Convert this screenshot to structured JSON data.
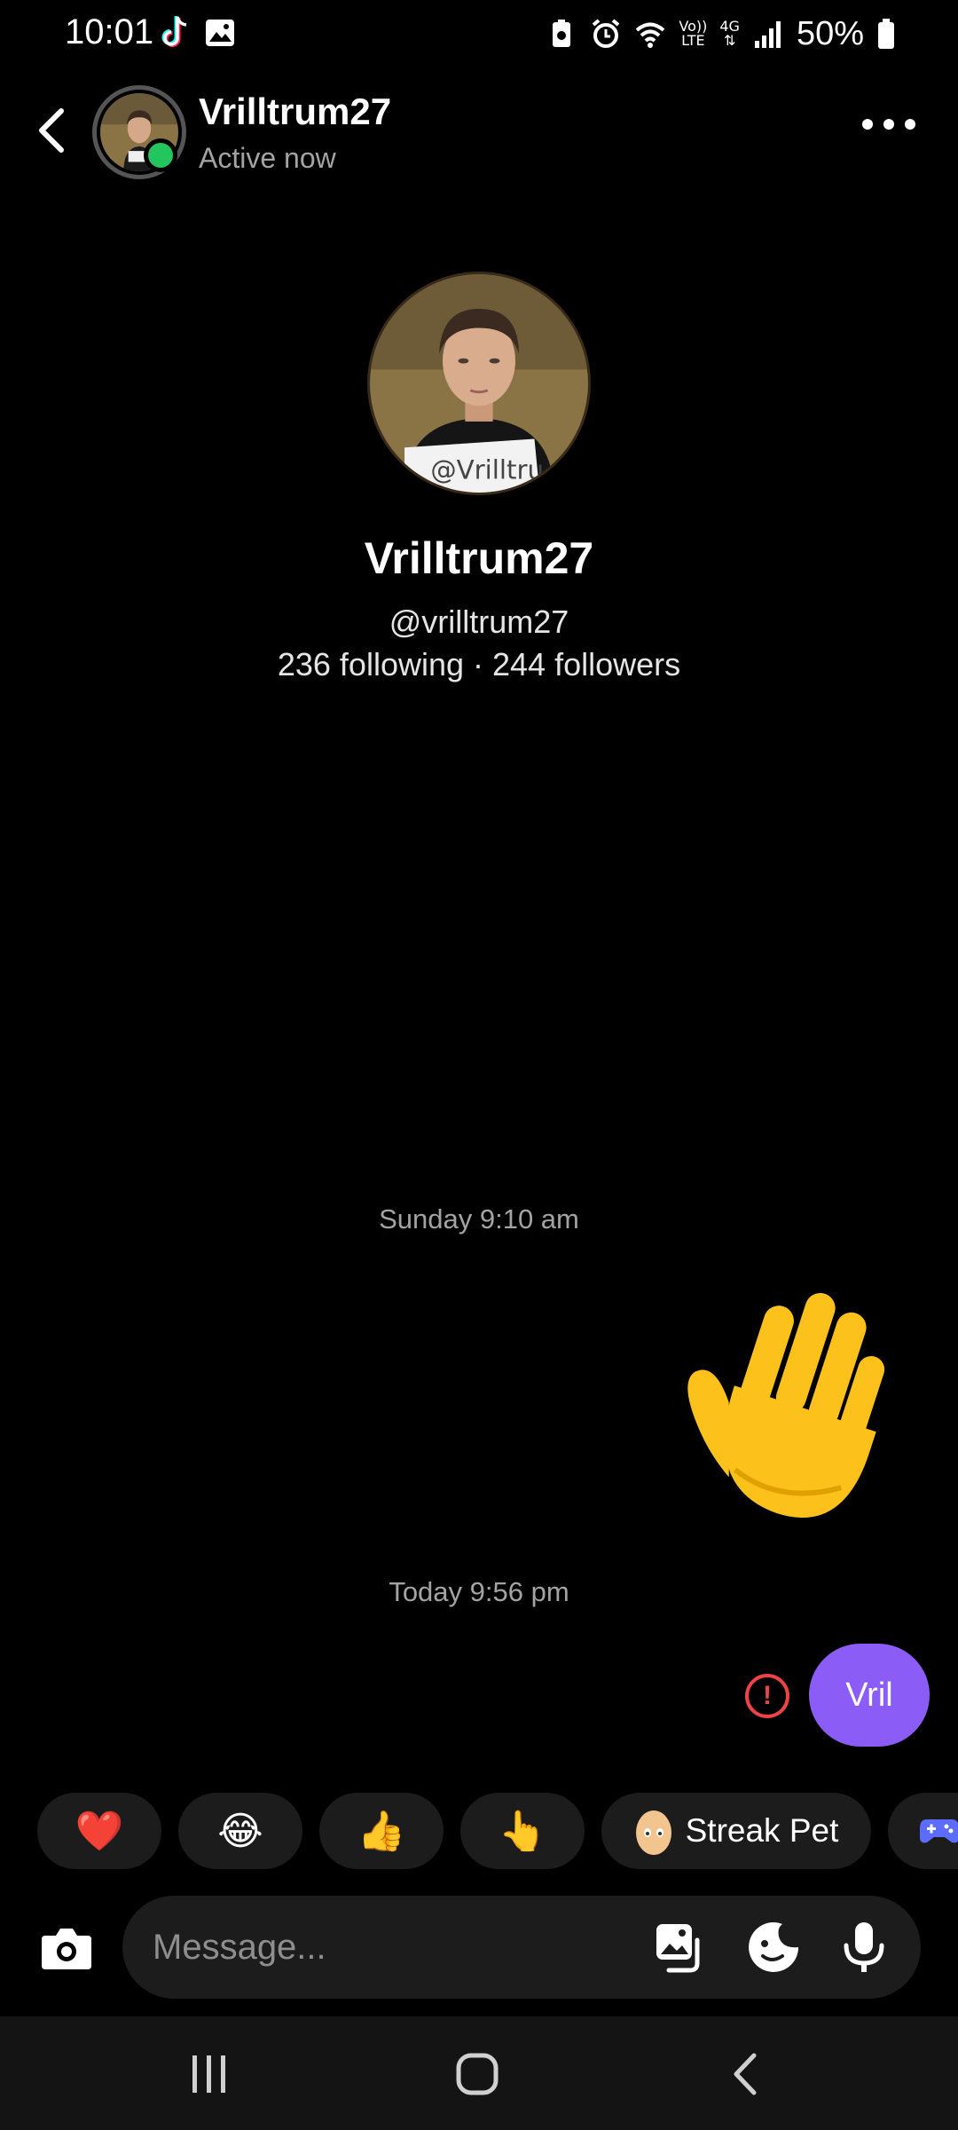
{
  "status_bar": {
    "time": "10:01",
    "volte_top": "Vo))",
    "volte_bottom": "LTE",
    "network": "4G",
    "battery": "50%"
  },
  "header": {
    "name": "Vrilltrum27",
    "status": "Active now",
    "online_color": "#22c55e"
  },
  "profile": {
    "name": "Vrilltrum27",
    "handle": "@vrilltrum27",
    "stats": "236 following · 244 followers",
    "photo_caption": "@Vrilltru"
  },
  "messages": {
    "timestamp_1": "Sunday 9:10 am",
    "wave_emoji": "waving-hand-emoji",
    "timestamp_2": "Today 9:56 pm",
    "outgoing_text": "Vril",
    "error_symbol": "!",
    "bubble_color": "#8b5cf6",
    "error_color": "#ef4444"
  },
  "quick_reactions": {
    "heart": "❤️",
    "laugh": "😂",
    "thumbs_up": "👍",
    "pointing": "👆",
    "streak_pet_label": "Streak Pet",
    "streak_pet_icon": "egg-icon",
    "game_icon": "gamepad-icon"
  },
  "composer": {
    "placeholder": "Message..."
  },
  "nav": {
    "recents": "recents-icon",
    "home": "home-icon",
    "back": "back-icon"
  }
}
